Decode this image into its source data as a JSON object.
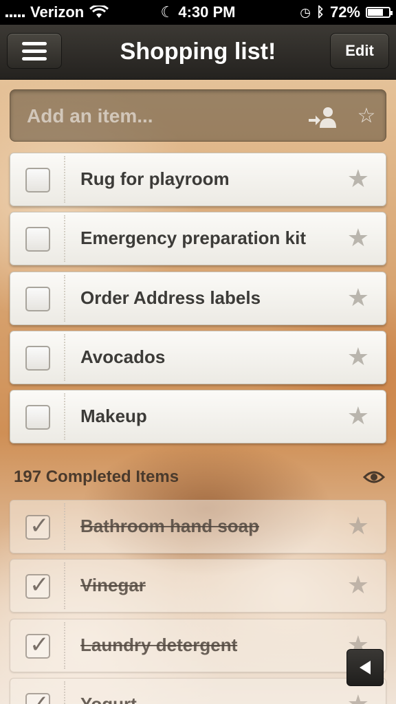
{
  "status_bar": {
    "carrier": "Verizon",
    "time": "4:30 PM",
    "battery": "72%",
    "battery_level": 0.72
  },
  "nav": {
    "title": "Shopping list!",
    "edit_label": "Edit",
    "menu_icon": "hamburger-icon"
  },
  "add_item": {
    "placeholder": "Add an item...",
    "assign_icon": "assign-person-icon",
    "star_icon": "star-outline-icon"
  },
  "tasks": [
    {
      "label": "Rug for playroom",
      "starred": false
    },
    {
      "label": "Emergency preparation kit",
      "starred": false
    },
    {
      "label": "Order Address labels",
      "starred": false
    },
    {
      "label": "Avocados",
      "starred": false
    },
    {
      "label": "Makeup",
      "starred": false
    }
  ],
  "completed": {
    "header": "197 Completed Items",
    "toggle_icon": "eye-icon",
    "items": [
      {
        "label": "Bathroom hand soap",
        "checked": true
      },
      {
        "label": "Vinegar",
        "checked": true
      },
      {
        "label": "Laundry detergent",
        "checked": true
      },
      {
        "label": "Yogurt",
        "checked": true
      }
    ]
  },
  "colors": {
    "nav_bg": "#2c2a26",
    "task_text": "#3c3b38",
    "completed_text": "#4a3a2c"
  }
}
